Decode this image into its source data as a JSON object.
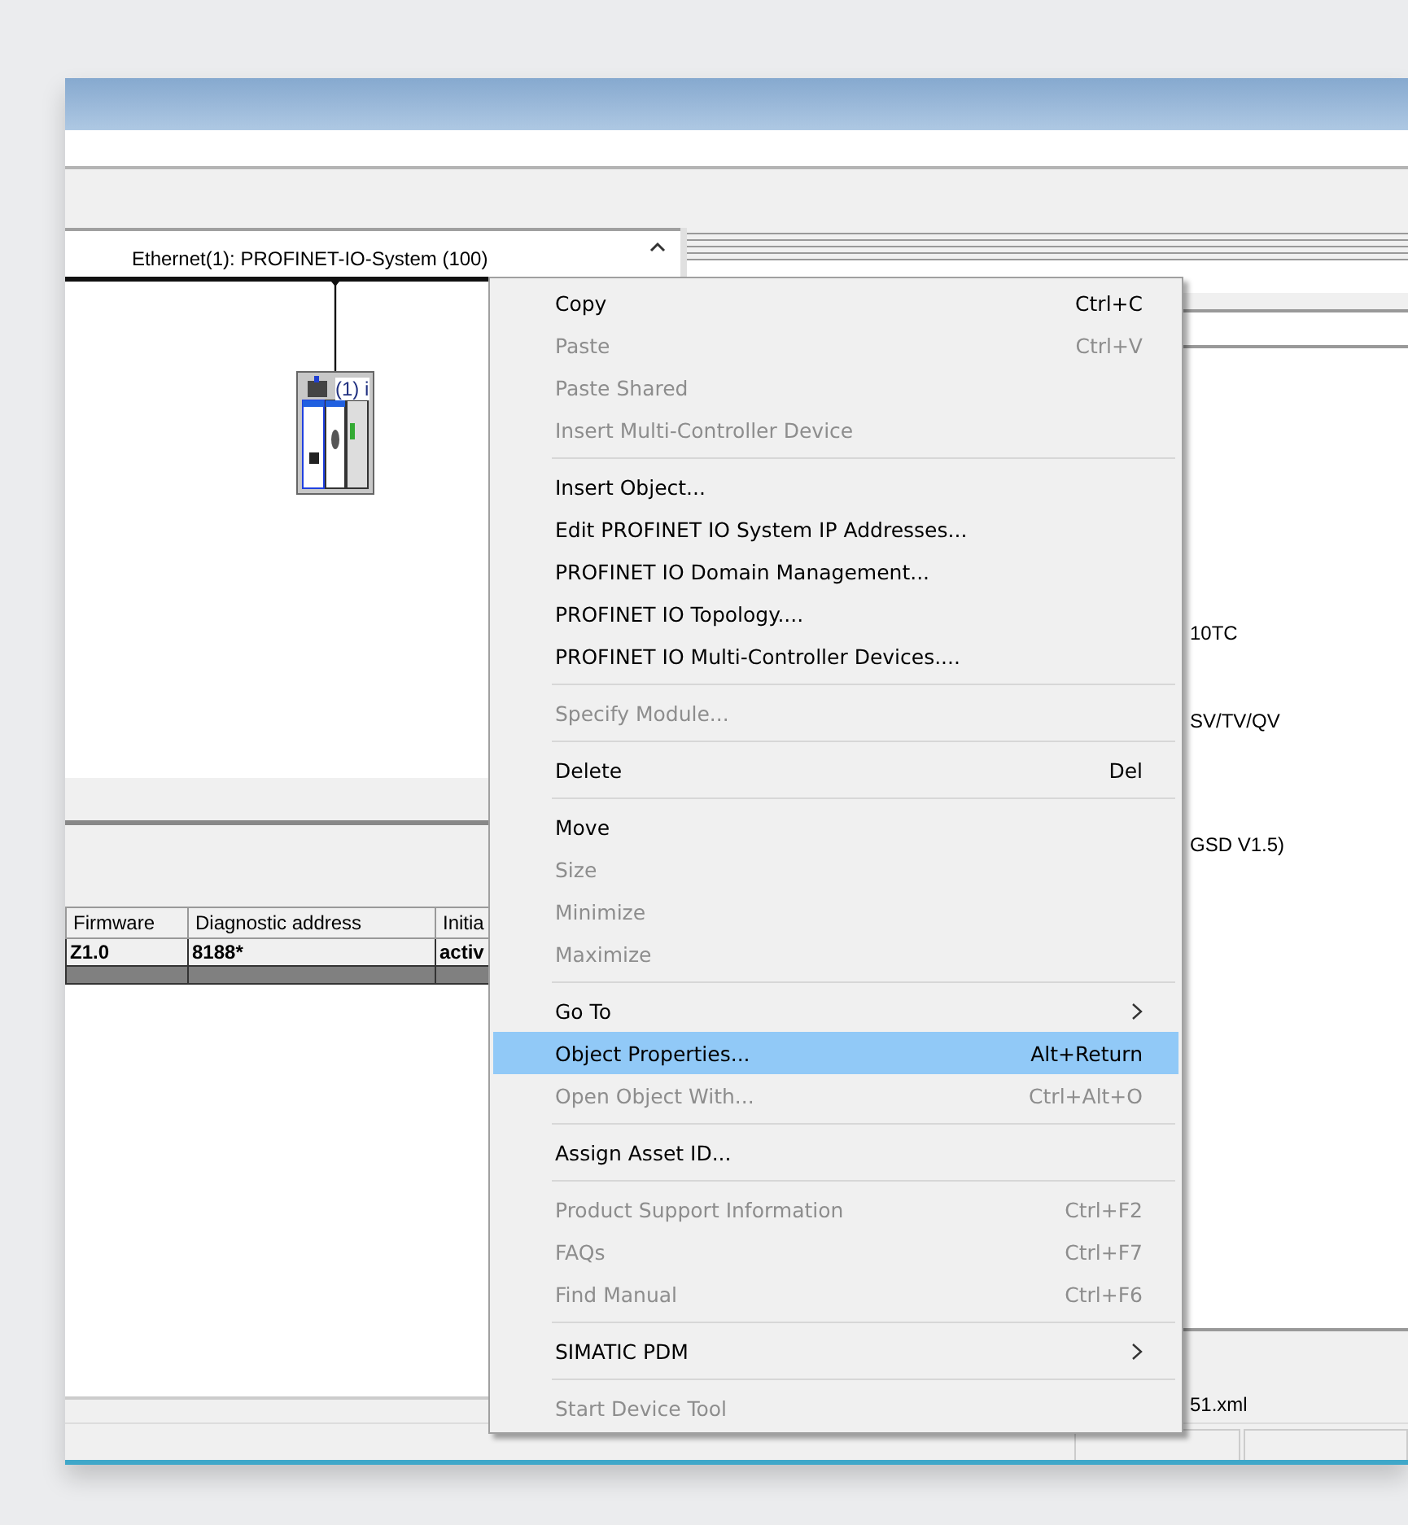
{
  "network_view": {
    "bus_label": "Ethernet(1): PROFINET-IO-System (100)",
    "device_label": "(1) i"
  },
  "details_table": {
    "columns": [
      "Firmware",
      "Diagnostic address",
      "Initia"
    ],
    "rows": [
      [
        "Z1.0",
        "8188*",
        "activ"
      ]
    ]
  },
  "properties_pane": {
    "lines": [
      {
        "text": "10TC"
      },
      {
        "text": "SV/TV/QV"
      },
      {
        "text": "GSD V1.5)"
      }
    ],
    "footer": "51.xml"
  },
  "context_menu": [
    {
      "kind": "item",
      "label": "Copy",
      "shortcut": "Ctrl+C",
      "disabled": false,
      "selected": false
    },
    {
      "kind": "item",
      "label": "Paste",
      "shortcut": "Ctrl+V",
      "disabled": true,
      "selected": false
    },
    {
      "kind": "item",
      "label": "Paste Shared",
      "disabled": true,
      "selected": false
    },
    {
      "kind": "item",
      "label": "Insert Multi-Controller Device",
      "disabled": true,
      "selected": false
    },
    {
      "kind": "separator"
    },
    {
      "kind": "item",
      "label": "Insert Object...",
      "disabled": false,
      "selected": false
    },
    {
      "kind": "item",
      "label": "Edit PROFINET IO System IP Addresses...",
      "disabled": false,
      "selected": false
    },
    {
      "kind": "item",
      "label": "PROFINET IO Domain Management...",
      "disabled": false,
      "selected": false
    },
    {
      "kind": "item",
      "label": "PROFINET IO Topology....",
      "disabled": false,
      "selected": false
    },
    {
      "kind": "item",
      "label": "PROFINET IO Multi-Controller Devices....",
      "disabled": false,
      "selected": false
    },
    {
      "kind": "separator"
    },
    {
      "kind": "item",
      "label": "Specify Module...",
      "disabled": true,
      "selected": false
    },
    {
      "kind": "separator"
    },
    {
      "kind": "item",
      "label": "Delete",
      "shortcut": "Del",
      "disabled": false,
      "selected": false
    },
    {
      "kind": "separator"
    },
    {
      "kind": "item",
      "label": "Move",
      "disabled": false,
      "selected": false
    },
    {
      "kind": "item",
      "label": "Size",
      "disabled": true,
      "selected": false
    },
    {
      "kind": "item",
      "label": "Minimize",
      "disabled": true,
      "selected": false
    },
    {
      "kind": "item",
      "label": "Maximize",
      "disabled": true,
      "selected": false
    },
    {
      "kind": "separator"
    },
    {
      "kind": "submenu",
      "label": "Go To",
      "disabled": false,
      "selected": false
    },
    {
      "kind": "item",
      "label": "Object Properties...",
      "shortcut": "Alt+Return",
      "disabled": false,
      "selected": true
    },
    {
      "kind": "item",
      "label": "Open Object With...",
      "shortcut": "Ctrl+Alt+O",
      "disabled": true,
      "selected": false
    },
    {
      "kind": "separator"
    },
    {
      "kind": "item",
      "label": "Assign Asset ID...",
      "disabled": false,
      "selected": false
    },
    {
      "kind": "separator"
    },
    {
      "kind": "item",
      "label": "Product Support Information",
      "shortcut": "Ctrl+F2",
      "disabled": true,
      "selected": false
    },
    {
      "kind": "item",
      "label": "FAQs",
      "shortcut": "Ctrl+F7",
      "disabled": true,
      "selected": false
    },
    {
      "kind": "item",
      "label": "Find Manual",
      "shortcut": "Ctrl+F6",
      "disabled": true,
      "selected": false
    },
    {
      "kind": "separator"
    },
    {
      "kind": "submenu",
      "label": "SIMATIC PDM",
      "disabled": false,
      "selected": false
    },
    {
      "kind": "separator"
    },
    {
      "kind": "item",
      "label": "Start Device Tool",
      "disabled": true,
      "selected": false
    }
  ]
}
